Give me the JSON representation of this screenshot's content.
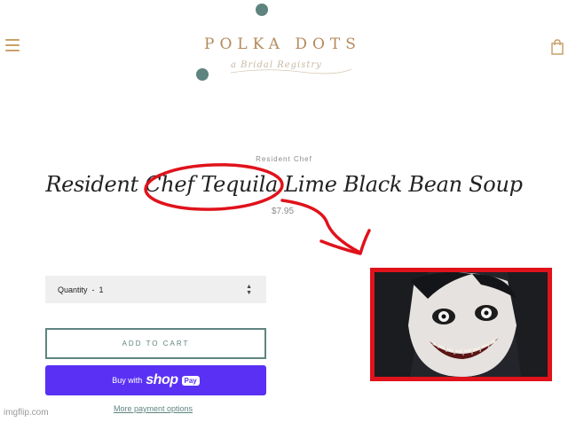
{
  "header": {
    "logo_text": "POLKA DOTS",
    "logo_tagline": "a Bridal Registry"
  },
  "product": {
    "vendor": "Resident Chef",
    "title": "Resident Chef Tequila Lime Black Bean Soup",
    "price": "$7.95"
  },
  "quantity": {
    "label": "Quantity",
    "separator": "-",
    "value": "1"
  },
  "buttons": {
    "add_to_cart": "ADD TO CART",
    "buy_with": "Buy with",
    "shop_word": "shop",
    "pay_word": "Pay",
    "more_payment": "More payment options"
  },
  "watermark": "imgflip.com",
  "colors": {
    "accent": "#5f8480",
    "logo_gold": "#b58a5a",
    "shop_pay": "#5a31f4",
    "annotation_red": "#e0121b"
  },
  "icons": [
    "menu-icon",
    "cart-bag-icon",
    "chevron-updown-icon"
  ]
}
